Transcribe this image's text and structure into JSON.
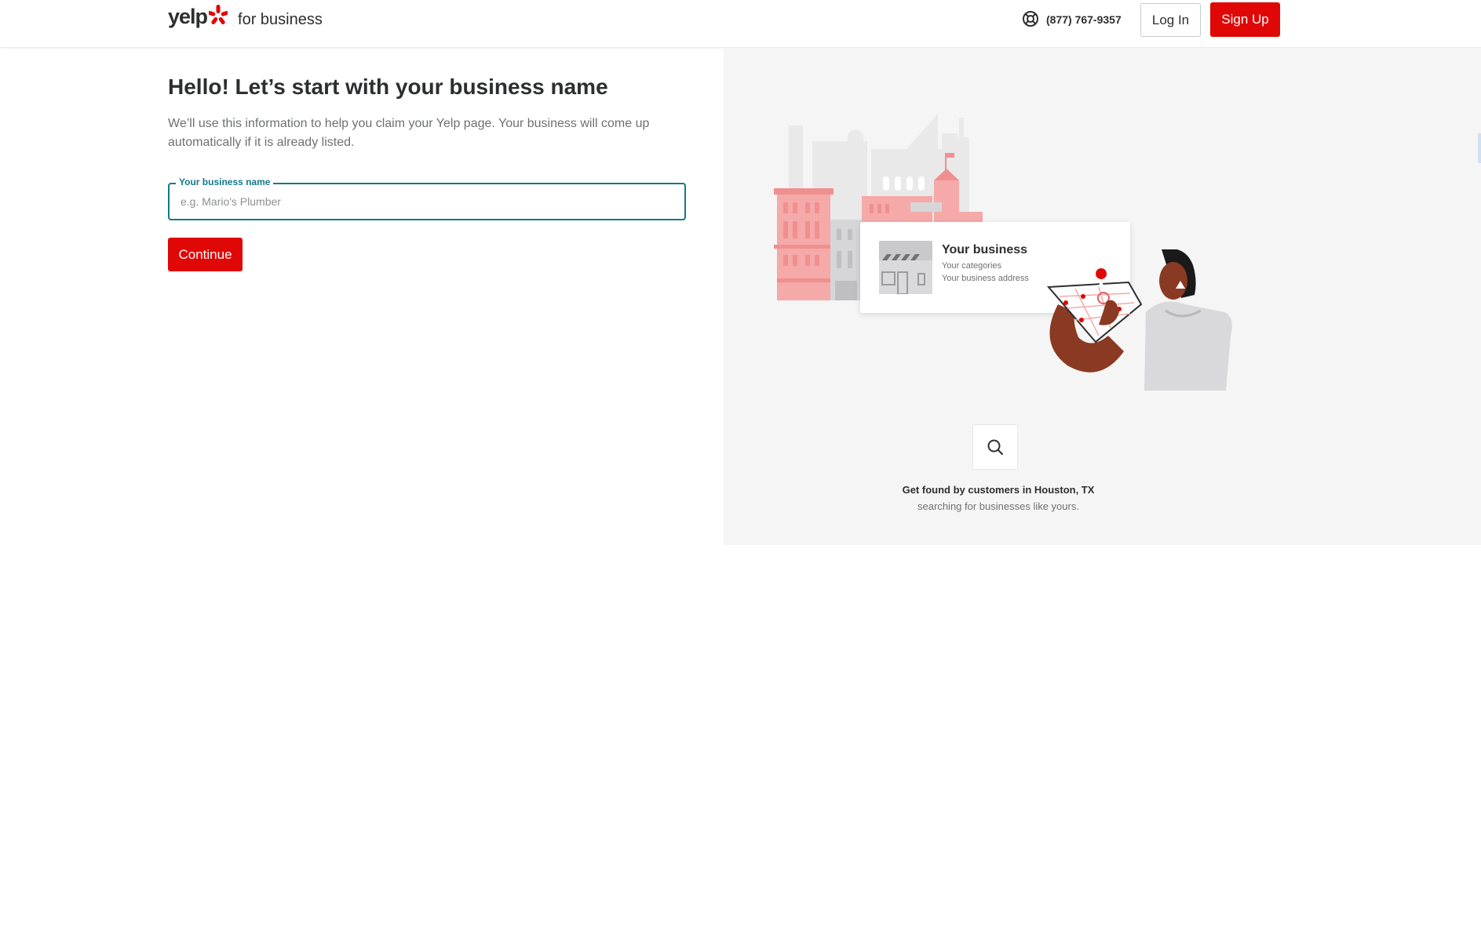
{
  "header": {
    "logo_wordmark": "yelp",
    "logo_sub": "for business",
    "phone_icon": "support-lifebuoy-icon",
    "phone": "(877) 767-9357",
    "login_label": "Log In",
    "signup_label": "Sign Up"
  },
  "form": {
    "title": "Hello! Let’s start with your business name",
    "subtitle": "We’ll use this information to help you claim your Yelp page. Your business will come up automatically if it is already listed.",
    "field_label": "Your business name",
    "field_value": "",
    "field_placeholder": "e.g. Mario's Plumber",
    "continue_label": "Continue"
  },
  "preview": {
    "card_title": "Your business",
    "card_line1": "Your categories",
    "card_line2": "Your business address",
    "search_icon": "search-icon",
    "found_line1": "Get found by customers in Houston, TX",
    "found_line2": "searching for businesses like yours."
  },
  "colors": {
    "brand_red": "#e00707",
    "focus_teal": "#127a8a",
    "panel_bg": "#f5f5f5"
  }
}
